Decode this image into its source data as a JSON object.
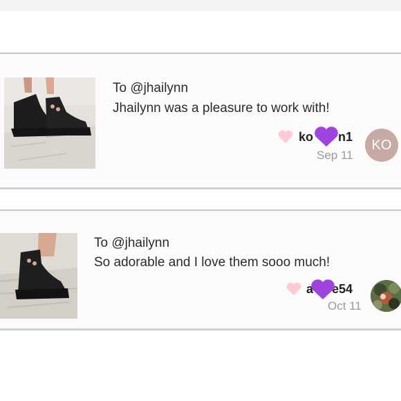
{
  "comments": [
    {
      "to_label": "To @jhailynn",
      "message": "Jhailynn was a pleasure to work with!",
      "username": "ko  n1",
      "date": "Sep 11",
      "avatar_initials": "KO"
    },
    {
      "to_label": "To @jhailynn",
      "message": "So adorable and I love them sooo much!",
      "username": "a  e54",
      "date": "Oct 11"
    }
  ],
  "colors": {
    "like_heart": "#ffc9d6",
    "purple_heart": "#a044e0",
    "avatar_bg": "#c6aaa5",
    "date_text": "#9a9a9a"
  },
  "icons": {
    "like": "heart-icon",
    "overlay": "purple-heart-icon"
  }
}
